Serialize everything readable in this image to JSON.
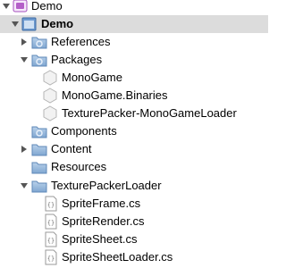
{
  "tree": {
    "solution": {
      "label": "Demo",
      "icon": "solution-icon"
    },
    "project": {
      "label": "Demo",
      "icon": "project-icon"
    },
    "references": {
      "label": "References",
      "icon": "folder-gear-icon"
    },
    "packages": {
      "label": "Packages",
      "icon": "folder-gear-icon"
    },
    "package_items": [
      {
        "label": "MonoGame",
        "icon": "package-icon"
      },
      {
        "label": "MonoGame.Binaries",
        "icon": "package-icon"
      },
      {
        "label": "TexturePacker-MonoGameLoader",
        "icon": "package-icon"
      }
    ],
    "components": {
      "label": "Components",
      "icon": "folder-gear-icon"
    },
    "content": {
      "label": "Content",
      "icon": "folder-icon"
    },
    "resources": {
      "label": "Resources",
      "icon": "folder-icon"
    },
    "texturepackerloader": {
      "label": "TexturePackerLoader",
      "icon": "folder-icon"
    },
    "files": [
      {
        "label": "SpriteFrame.cs",
        "icon": "csharp-file-icon"
      },
      {
        "label": "SpriteRender.cs",
        "icon": "csharp-file-icon"
      },
      {
        "label": "SpriteSheet.cs",
        "icon": "csharp-file-icon"
      },
      {
        "label": "SpriteSheetLoader.cs",
        "icon": "csharp-file-icon"
      }
    ]
  },
  "colors": {
    "folder": "#8fb3d9",
    "selection": "#dcdcdc",
    "solution": "#b45fc8",
    "arrow": "#555555"
  }
}
